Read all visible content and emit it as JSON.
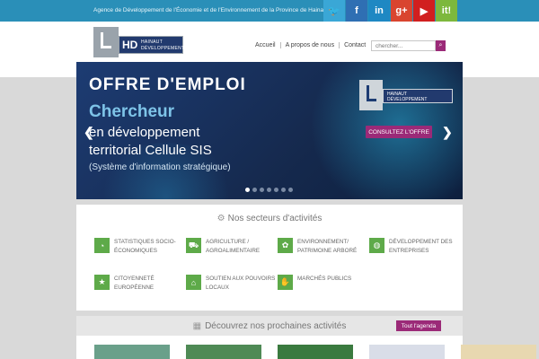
{
  "topbar": {
    "tagline": "Agence de Développement de l'Économie et de l'Environnement de la Province de Hainaut",
    "social": [
      {
        "name": "twitter-icon",
        "glyph": "🐦",
        "color": "#3aa7d6"
      },
      {
        "name": "facebook-icon",
        "glyph": "f",
        "color": "#2f6fb3"
      },
      {
        "name": "linkedin-icon",
        "glyph": "in",
        "color": "#1e88c3"
      },
      {
        "name": "googleplus-icon",
        "glyph": "g+",
        "color": "#d9452f"
      },
      {
        "name": "youtube-icon",
        "glyph": "▶",
        "color": "#d11f1f"
      },
      {
        "name": "itunes-icon",
        "glyph": "it!",
        "color": "#7db83d"
      }
    ]
  },
  "header": {
    "logo": {
      "hd": "HD",
      "line1": "HAINAUT",
      "line2": "DÉVELOPPEMENT"
    },
    "nav": [
      "Accueil",
      "A propos de nous",
      "Contact"
    ],
    "search": {
      "placeholder": "chercher..."
    }
  },
  "banner": {
    "title": "OFFRE D'EMPLOI",
    "sub1": "Chercheur",
    "sub2": "en développement",
    "sub3": "territorial Cellule SIS",
    "sub4": "(Système d'information stratégique)",
    "logo": {
      "line1": "HAINAUT",
      "line2": "DÉVELOPPEMENT"
    },
    "cta": "CONSULTEZ L'OFFRE",
    "dots": 7,
    "active_dot": 0
  },
  "sectors": {
    "title": "Nos secteurs d'activités",
    "items": [
      {
        "icon": "chart-icon",
        "glyph": "◔",
        "label": "Statistiques socio-économiques"
      },
      {
        "icon": "tractor-icon",
        "glyph": "⛟",
        "label": "Agriculture / agroalimentaire"
      },
      {
        "icon": "plant-icon",
        "glyph": "✿",
        "label": "Environnement/ patrimoine arboré"
      },
      {
        "icon": "globe-icon",
        "glyph": "◍",
        "label": "Développement des entreprises"
      },
      {
        "icon": "star-icon",
        "glyph": "★",
        "label": "Citoyenneté européenne"
      },
      {
        "icon": "building-icon",
        "glyph": "⌂",
        "label": "Soutien aux pouvoirs locaux"
      },
      {
        "icon": "handshake-icon",
        "glyph": "✋",
        "label": "Marchés publics"
      }
    ]
  },
  "activities": {
    "title": "Découvrez nos prochaines activités",
    "agenda": "Tout l'agenda",
    "thumbs": [
      "#6aa08a",
      "#4f8a55",
      "#3a7a3f",
      "#d9dde8",
      "#e8d8b0"
    ]
  }
}
